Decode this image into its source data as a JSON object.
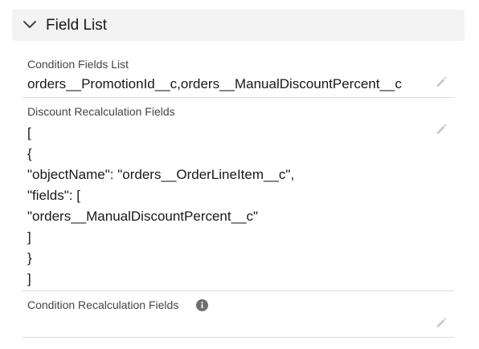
{
  "section": {
    "title": "Field List",
    "icon": "chevron-down-icon"
  },
  "fields": [
    {
      "label": "Condition Fields List",
      "value": "orders__PromotionId__c,orders__ManualDiscountPercent__c"
    },
    {
      "label": "Discount Recalculation Fields",
      "lines": [
        "[",
        "{",
        "\"objectName\": \"orders__OrderLineItem__c\",",
        "\"fields\": [",
        "\"orders__ManualDiscountPercent__c\"",
        "]",
        "}",
        "]"
      ]
    },
    {
      "label": "Condition Recalculation Fields",
      "value": "",
      "has_info_icon": true
    }
  ],
  "icons": {
    "edit": "pencil-edit-icon",
    "info": "info-icon"
  },
  "colors": {
    "header_bg": "#f3f3f3",
    "divider": "#dddbda",
    "label": "#444444",
    "icon_gray": "#c9c9c9",
    "info_icon": "#706e6b"
  }
}
